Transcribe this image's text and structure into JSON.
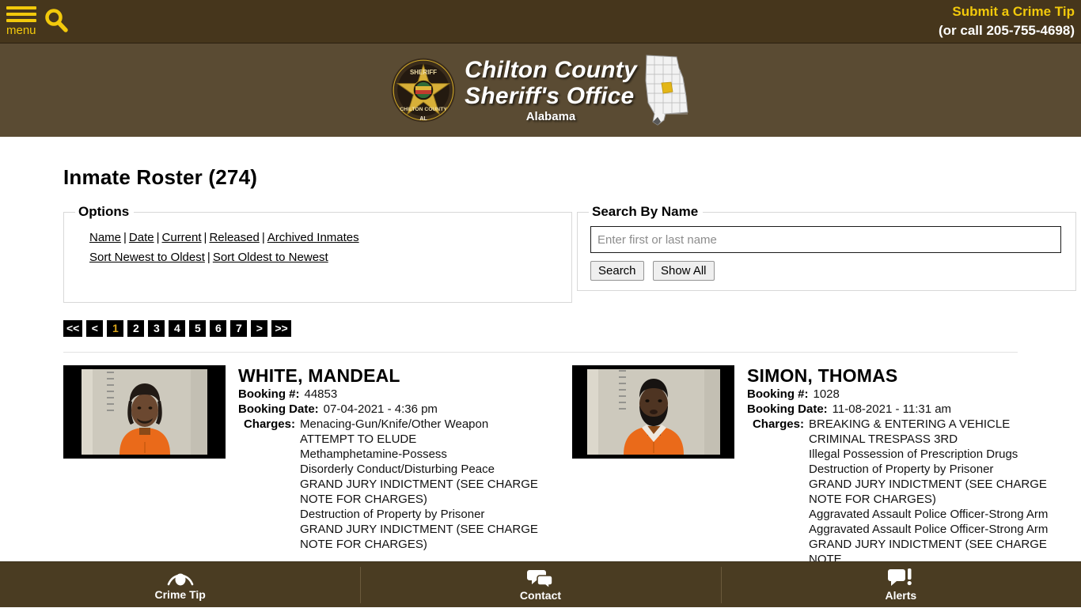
{
  "topbar": {
    "menu_label": "menu",
    "menu_icon": "hamburger-icon",
    "search_icon": "search-icon",
    "crime_tip_link": "Submit a Crime Tip",
    "crime_tip_phone": "(or call 205-755-4698)",
    "bg_color": "#46361c",
    "accent_color": "#f2c90b"
  },
  "header": {
    "badge_icon": "sheriff-badge-icon",
    "badge_top_text": "SHERIFF",
    "badge_bottom_text": "CHILTON COUNTY",
    "badge_state_abbr": "AL",
    "title_line1": "Chilton County",
    "title_line2": "Sheriff's Office",
    "title_line3": "Alabama",
    "map_icon": "alabama-state-map-icon",
    "bg_color": "#5a4b33"
  },
  "main": {
    "page_title": "Inmate Roster (274)",
    "options": {
      "legend": "Options",
      "filters": [
        {
          "label": "Name"
        },
        {
          "label": "Date"
        },
        {
          "label": "Current"
        },
        {
          "label": "Released"
        },
        {
          "label": "Archived Inmates"
        }
      ],
      "sorts": [
        {
          "label": "Sort Newest to Oldest"
        },
        {
          "label": "Sort Oldest to Newest"
        }
      ],
      "separator": "|"
    },
    "search": {
      "legend": "Search By Name",
      "input_value": "",
      "placeholder": "Enter first or last name",
      "search_button": "Search",
      "show_all_button": "Show All"
    },
    "pagination": {
      "first": "<<",
      "prev": "<",
      "pages": [
        "1",
        "2",
        "3",
        "4",
        "5",
        "6",
        "7"
      ],
      "active_page": "1",
      "next": ">",
      "last": ">>",
      "active_color": "#d9a41b"
    },
    "labels": {
      "booking_number": "Booking #:",
      "booking_date": "Booking Date:",
      "charges": "Charges:"
    },
    "inmates": [
      {
        "name": "WHITE, MANDEAL",
        "booking_number": "44853",
        "booking_date": "07-04-2021 - 4:36 pm",
        "mugshot": "inmate-mugshot",
        "charges": [
          "Menacing-Gun/Knife/Other Weapon",
          "ATTEMPT TO ELUDE",
          "Methamphetamine-Possess",
          "Disorderly Conduct/Disturbing Peace",
          "GRAND JURY INDICTMENT (SEE CHARGE NOTE FOR CHARGES)",
          "Destruction of Property by Prisoner",
          "GRAND JURY INDICTMENT (SEE CHARGE NOTE FOR CHARGES)"
        ]
      },
      {
        "name": "SIMON, THOMAS",
        "booking_number": "1028",
        "booking_date": "11-08-2021 - 11:31 am",
        "mugshot": "inmate-mugshot",
        "charges": [
          "BREAKING & ENTERING A VEHICLE",
          "CRIMINAL TRESPASS 3RD",
          "Illegal Possession of Prescription Drugs",
          "Destruction of Property by Prisoner",
          "GRAND JURY INDICTMENT (SEE CHARGE NOTE FOR CHARGES)",
          "Aggravated Assault Police Officer-Strong Arm",
          "Aggravated Assault Police Officer-Strong Arm",
          "GRAND JURY INDICTMENT (SEE CHARGE NOTE"
        ]
      }
    ]
  },
  "footer": {
    "items": [
      {
        "label": "Crime Tip",
        "icon": "eye-icon"
      },
      {
        "label": "Contact",
        "icon": "speech-bubbles-icon"
      },
      {
        "label": "Alerts",
        "icon": "alert-bubble-icon"
      }
    ],
    "bg_color": "#4a3c22"
  }
}
